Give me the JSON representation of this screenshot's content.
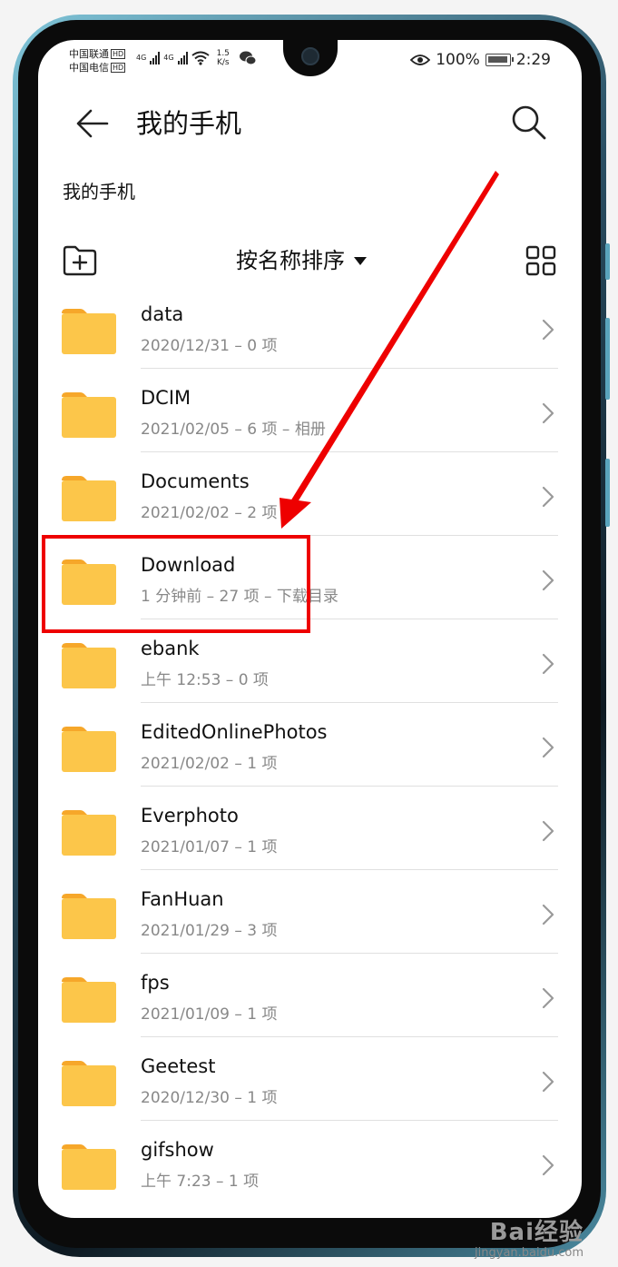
{
  "status_bar": {
    "carrier1": "中国联通",
    "carrier2": "中国电信",
    "hd": "HD",
    "net1": "4G",
    "net2": "4G",
    "speed_value": "1.5",
    "speed_unit": "K/s",
    "battery": "100%",
    "battery_level": 1.0,
    "time": "2:29"
  },
  "header": {
    "title": "我的手机",
    "breadcrumb": "我的手机"
  },
  "toolbar": {
    "sort_label": "按名称排序"
  },
  "files": [
    {
      "name": "data",
      "meta": "2020/12/31 – 0 项"
    },
    {
      "name": "DCIM",
      "meta": "2021/02/05 – 6 项 – 相册"
    },
    {
      "name": "Documents",
      "meta": "2021/02/02 – 2 项"
    },
    {
      "name": "Download",
      "meta": "1 分钟前 – 27 项 – 下载目录"
    },
    {
      "name": "ebank",
      "meta": "上午 12:53  – 0 项"
    },
    {
      "name": "EditedOnlinePhotos",
      "meta": "2021/02/02 – 1 项"
    },
    {
      "name": "Everphoto",
      "meta": "2021/01/07 – 1 项"
    },
    {
      "name": "FanHuan",
      "meta": "2021/01/29 – 3 项"
    },
    {
      "name": "fps",
      "meta": "2021/01/09 – 1 项"
    },
    {
      "name": "Geetest",
      "meta": "2020/12/30 – 1 项"
    },
    {
      "name": "gifshow",
      "meta": "上午 7:23  – 1 项"
    }
  ],
  "watermark": {
    "logo": "Bai经验",
    "url": "jingyan.baidu.com"
  },
  "colors": {
    "folder": "#fcc64a",
    "folder_tab": "#f6a72a",
    "annotation": "#ee0000"
  }
}
